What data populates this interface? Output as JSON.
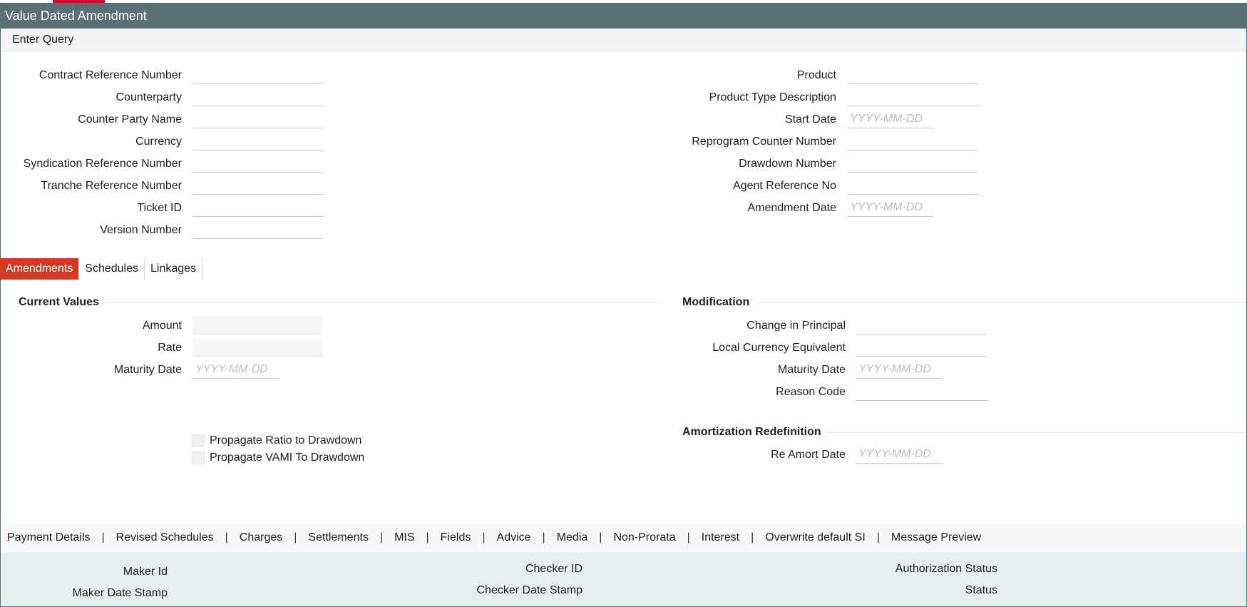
{
  "window": {
    "title": "Value Dated Amendment"
  },
  "toolbar": {
    "enter_query": "Enter Query"
  },
  "form": {
    "contract_ref": {
      "label": "Contract Reference Number",
      "value": ""
    },
    "counterparty": {
      "label": "Counterparty",
      "value": ""
    },
    "counterparty_name": {
      "label": "Counter Party Name",
      "value": ""
    },
    "currency": {
      "label": "Currency",
      "value": ""
    },
    "syndication_ref": {
      "label": "Syndication Reference Number",
      "value": ""
    },
    "tranche_ref": {
      "label": "Tranche Reference Number",
      "value": ""
    },
    "ticket_id": {
      "label": "Ticket ID",
      "value": ""
    },
    "version_number": {
      "label": "Version Number",
      "value": ""
    },
    "product": {
      "label": "Product",
      "value": ""
    },
    "product_type_desc": {
      "label": "Product Type Description",
      "value": ""
    },
    "start_date": {
      "label": "Start Date",
      "placeholder": "YYYY-MM-DD"
    },
    "reprogram_counter": {
      "label": "Reprogram Counter Number",
      "value": ""
    },
    "drawdown_number": {
      "label": "Drawdown Number",
      "value": ""
    },
    "agent_ref": {
      "label": "Agent Reference No",
      "value": ""
    },
    "amendment_date": {
      "label": "Amendment Date",
      "placeholder": "YYYY-MM-DD"
    }
  },
  "tabs": [
    {
      "label": "Amendments",
      "active": true
    },
    {
      "label": "Schedules",
      "active": false
    },
    {
      "label": "Linkages",
      "active": false
    }
  ],
  "current_values": {
    "title": "Current Values",
    "amount": {
      "label": "Amount",
      "value": ""
    },
    "rate": {
      "label": "Rate",
      "value": ""
    },
    "maturity_date": {
      "label": "Maturity Date",
      "placeholder": "YYYY-MM-DD"
    }
  },
  "modification": {
    "title": "Modification",
    "change_in_principal": {
      "label": "Change in Principal",
      "value": ""
    },
    "local_ccy_equiv": {
      "label": "Local Currency Equivalent",
      "value": ""
    },
    "maturity_date": {
      "label": "Maturity Date",
      "placeholder": "YYYY-MM-DD"
    },
    "reason_code": {
      "label": "Reason Code",
      "value": ""
    }
  },
  "amortization": {
    "title": "Amortization Redefinition",
    "re_amort_date": {
      "label": "Re Amort Date",
      "placeholder": "YYYY-MM-DD"
    }
  },
  "checkboxes": {
    "propagate_ratio": {
      "label": "Propagate Ratio to Drawdown",
      "checked": false
    },
    "propagate_vami": {
      "label": "Propagate VAMI To Drawdown",
      "checked": false
    }
  },
  "links": [
    "Payment Details",
    "Revised Schedules",
    "Charges",
    "Settlements",
    "MIS",
    "Fields",
    "Advice",
    "Media",
    "Non-Prorata",
    "Interest",
    "Overwrite default SI",
    "Message Preview"
  ],
  "link_separator": "|",
  "audit": {
    "maker_id": "Maker Id",
    "maker_date_stamp": "Maker Date Stamp",
    "checker_id": "Checker ID",
    "checker_date_stamp": "Checker Date Stamp",
    "authorization_status": "Authorization Status",
    "status": "Status"
  },
  "colors": {
    "titlebar": "#5a7077",
    "active_tab": "#cf3a26",
    "audit_bg": "#e5eef1",
    "accent": "#c8102e"
  }
}
